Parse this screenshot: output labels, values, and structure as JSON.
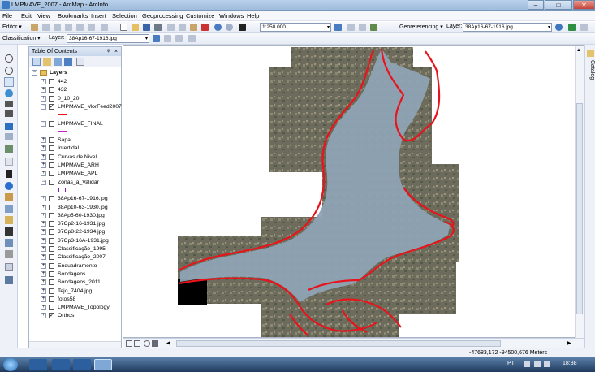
{
  "window": {
    "title": "LMPMAVE_2007 - ArcMap - ArcInfo",
    "minimize": "–",
    "maximize": "□",
    "close": "✕"
  },
  "menus": [
    "File",
    "Edit",
    "View",
    "Bookmarks",
    "Insert",
    "Selection",
    "Geoprocessing",
    "Customize",
    "Windows",
    "Help"
  ],
  "toolbar1": {
    "editor": "Editor ▾",
    "scale": "1:250.000",
    "georef": "Georeferencing ▾",
    "layer_label": "Layer:",
    "layer_value": "38Ap16-67-1916.jpg"
  },
  "toolbar2": {
    "classification": "Classification ▾",
    "layer_label": "Layer:",
    "layer_value": "38Ap16-67-1916.jpg"
  },
  "toc": {
    "title": "Table Of Contents",
    "pin": "ᵠ",
    "close": "×",
    "group": "Layers",
    "layers": [
      {
        "name": "442",
        "checked": false,
        "expanded": false
      },
      {
        "name": "432",
        "checked": false,
        "expanded": false
      },
      {
        "name": "0_10_20",
        "checked": false,
        "expanded": false
      },
      {
        "name": "LMPMAVE_MorFeed2007",
        "checked": true,
        "expanded": true,
        "legend": "red-line"
      },
      {
        "name": "LMPMAVE_FINAL",
        "checked": false,
        "expanded": true,
        "legend": "magenta-line"
      },
      {
        "name": "Sapal",
        "checked": false,
        "expanded": false
      },
      {
        "name": "Intertidal",
        "checked": false,
        "expanded": false
      },
      {
        "name": "Curvas de Nivel",
        "checked": false,
        "expanded": false
      },
      {
        "name": "LMPMAVE_ARH",
        "checked": false,
        "expanded": false
      },
      {
        "name": "LMPMAVE_APL",
        "checked": false,
        "expanded": false
      },
      {
        "name": "Zonas_a_Validar",
        "checked": false,
        "expanded": true,
        "legend": "purple-box"
      },
      {
        "name": "38Ap16-67-1916.jpg",
        "checked": false,
        "expanded": false
      },
      {
        "name": "38Ap10-63-1930.jpg",
        "checked": false,
        "expanded": false
      },
      {
        "name": "38Ap5-60-1930.jpg",
        "checked": false,
        "expanded": false
      },
      {
        "name": "37Cp2-16-1931.jpg",
        "checked": false,
        "expanded": false
      },
      {
        "name": "37Cp8-22-1934.jpg",
        "checked": false,
        "expanded": false
      },
      {
        "name": "37Cp3-16A-1931.jpg",
        "checked": false,
        "expanded": false
      },
      {
        "name": "Classificação_1995",
        "checked": false,
        "expanded": false
      },
      {
        "name": "Classificação_2007",
        "checked": false,
        "expanded": false
      },
      {
        "name": "Enquadramento",
        "checked": false,
        "expanded": false
      },
      {
        "name": "Sondagens",
        "checked": false,
        "expanded": false
      },
      {
        "name": "Sondagens_2011",
        "checked": false,
        "expanded": false
      },
      {
        "name": "Tejo_7404.jpg",
        "checked": false,
        "expanded": false
      },
      {
        "name": "fotos58",
        "checked": false,
        "expanded": false
      },
      {
        "name": "LMPMAVE_Topology",
        "checked": false,
        "expanded": false
      },
      {
        "name": "Orthos",
        "checked": true,
        "expanded": false
      }
    ]
  },
  "catalog_label": "Catalog",
  "status": {
    "coordinates": "-47683,172  -94500,676 Meters"
  },
  "taskbar": {
    "lang": "PT",
    "time": "18:38"
  },
  "colors": {
    "shoreline": "#e8141c",
    "water": "#8aa0b2",
    "land": "#6b6a58"
  }
}
